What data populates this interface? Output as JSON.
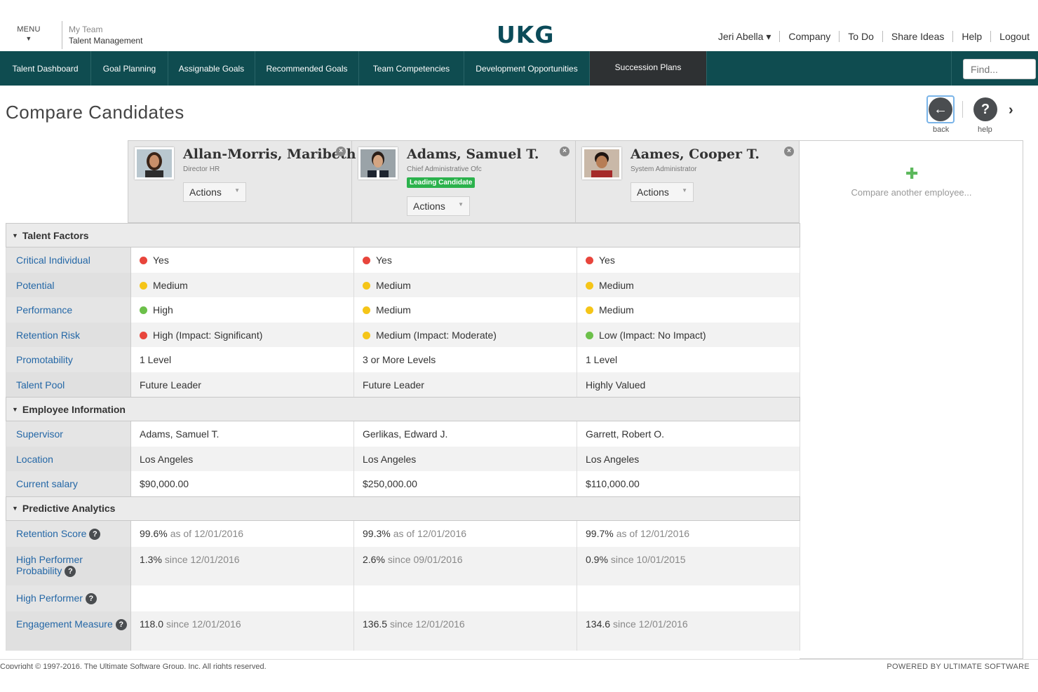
{
  "header": {
    "menu_label": "MENU",
    "context_line1": "My Team",
    "context_line2": "Talent Management",
    "logo": "UKG",
    "links": [
      "Jeri Abella ▾",
      "Company",
      "To Do",
      "Share Ideas",
      "Help",
      "Logout"
    ]
  },
  "nav": {
    "tabs": [
      "Talent Dashboard",
      "Goal Planning",
      "Assignable Goals",
      "Recommended Goals",
      "Team Competencies",
      "Development Opportunities",
      "Succession Plans"
    ],
    "active_tab": "Succession Plans",
    "find_placeholder": "Find..."
  },
  "page": {
    "title": "Compare Candidates",
    "back_label": "back",
    "help_label": "help"
  },
  "candidates": [
    {
      "name": "Allan-Morris, Maribeth",
      "title": "Director HR",
      "badge": "",
      "actions": "Actions"
    },
    {
      "name": "Adams, Samuel T.",
      "title": "Chief Administrative Ofc",
      "badge": "Leading Candidate",
      "actions": "Actions"
    },
    {
      "name": "Aames, Cooper T.",
      "title": "System Administrator",
      "badge": "",
      "actions": "Actions"
    }
  ],
  "compare_another": "Compare another employee...",
  "sections": {
    "talent_factors": "Talent Factors",
    "employee_information": "Employee Information",
    "predictive_analytics": "Predictive Analytics"
  },
  "talent_rows": [
    {
      "label": "Critical Individual",
      "values": [
        "Yes",
        "Yes",
        "Yes"
      ],
      "dots": [
        "red",
        "red",
        "red"
      ]
    },
    {
      "label": "Potential",
      "values": [
        "Medium",
        "Medium",
        "Medium"
      ],
      "dots": [
        "yellow",
        "yellow",
        "yellow"
      ]
    },
    {
      "label": "Performance",
      "values": [
        "High",
        "Medium",
        "Medium"
      ],
      "dots": [
        "green",
        "yellow",
        "yellow"
      ]
    },
    {
      "label": "Retention Risk",
      "values": [
        "High (Impact: Significant)",
        "Medium (Impact: Moderate)",
        "Low (Impact: No Impact)"
      ],
      "dots": [
        "red",
        "yellow",
        "green"
      ]
    },
    {
      "label": "Promotability",
      "values": [
        "1 Level",
        "3 or More Levels",
        "1 Level"
      ],
      "dots": [
        "",
        "",
        ""
      ]
    },
    {
      "label": "Talent Pool",
      "values": [
        "Future Leader",
        "Future Leader",
        "Highly Valued"
      ],
      "dots": [
        "",
        "",
        ""
      ]
    }
  ],
  "employee_rows": [
    {
      "label": "Supervisor",
      "values": [
        "Adams, Samuel T.",
        "Gerlikas, Edward J.",
        "Garrett, Robert O."
      ]
    },
    {
      "label": "Location",
      "values": [
        "Los Angeles",
        "Los Angeles",
        "Los Angeles"
      ]
    },
    {
      "label": "Current salary",
      "values": [
        "$90,000.00",
        "$250,000.00",
        "$110,000.00"
      ]
    }
  ],
  "predictive_rows": [
    {
      "label": "Retention Score",
      "values": [
        [
          "99.6%",
          "as of 12/01/2016"
        ],
        [
          "99.3%",
          "as of 12/01/2016"
        ],
        [
          "99.7%",
          "as of 12/01/2016"
        ]
      ]
    },
    {
      "label": "High Performer Probability",
      "values": [
        [
          "1.3%",
          "since 12/01/2016"
        ],
        [
          "2.6%",
          "since 09/01/2016"
        ],
        [
          "0.9%",
          "since 10/01/2015"
        ]
      ]
    },
    {
      "label": "High Performer",
      "values": [
        [
          "",
          ""
        ],
        [
          "",
          ""
        ],
        [
          "",
          ""
        ]
      ]
    },
    {
      "label": "Engagement Measure",
      "values": [
        [
          "118.0",
          "since 12/01/2016"
        ],
        [
          "136.5",
          "since 12/01/2016"
        ],
        [
          "134.6",
          "since 12/01/2016"
        ]
      ]
    }
  ],
  "colors": {
    "red": "#e8453c",
    "yellow": "#f5c518",
    "green": "#6cc04a",
    "nav_bg": "#0f4c50",
    "link": "#2467a6"
  },
  "footer": {
    "copyright": "Copyright © 1997-2016. The Ultimate Software Group, Inc. All rights reserved.",
    "powered": "POWERED BY ULTIMATE SOFTWARE"
  }
}
